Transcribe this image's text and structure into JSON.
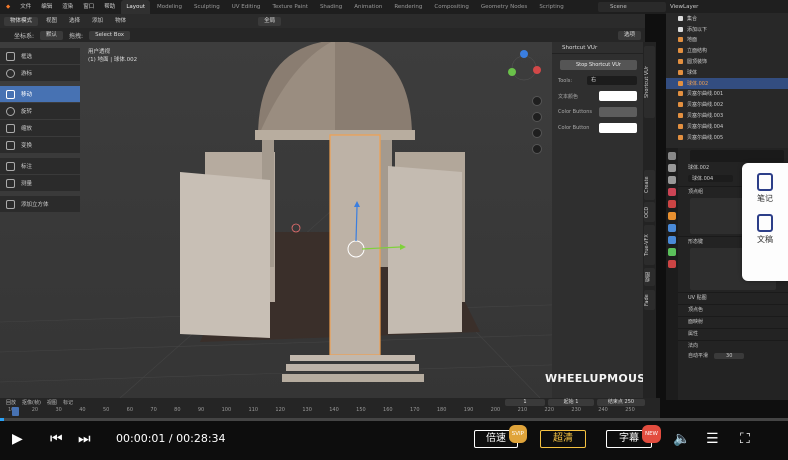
{
  "topbar": {
    "menus": [
      "文件",
      "编辑",
      "渲染",
      "窗口",
      "帮助"
    ],
    "workspaces": [
      "Layout",
      "Modeling",
      "Sculpting",
      "UV Editing",
      "Texture Paint",
      "Shading",
      "Animation",
      "Rendering",
      "Compositing",
      "Geometry Nodes",
      "Scripting"
    ],
    "scene_label": "Scene",
    "view_layer_label": "ViewLayer"
  },
  "viewport_header": {
    "mode": "物体模式",
    "menus": [
      "视图",
      "选择",
      "添加",
      "物体"
    ],
    "orientation": "全局",
    "options_label": "选项"
  },
  "viewport_header2": {
    "coord_label": "坐标系:",
    "coord_value": "默认",
    "drag_label": "拖拽:",
    "drag_value": "Select Box"
  },
  "viewport_info": {
    "line1": "用户透视",
    "line2": "(1) 地面 | 球体.002"
  },
  "toolbar": {
    "tools": [
      {
        "label": "框选",
        "active": false
      },
      {
        "label": "游标",
        "active": false
      },
      {
        "label": "移动",
        "active": true
      },
      {
        "label": "旋转",
        "active": false
      },
      {
        "label": "缩放",
        "active": false
      },
      {
        "label": "变换",
        "active": false
      },
      {
        "label": "标注",
        "active": false
      },
      {
        "label": "测量",
        "active": false
      },
      {
        "label": "添加立方体",
        "active": false
      }
    ]
  },
  "npanel": {
    "title": "Shortcut VUr",
    "stop_button": "Stop Shortcut VUr",
    "tools_label": "Tools:",
    "tools_value": "右",
    "text_color_label": "文本颜色",
    "color_buttons_label": "Color Buttons",
    "color_button_label": "Color Button",
    "side_tabs": [
      "Shortcut VUr",
      "Create",
      "OCD",
      "True-VFX",
      "视图",
      "Fade"
    ]
  },
  "watermark": "WHEELUPMOUSE",
  "outliner": {
    "rows": [
      {
        "label": "集合",
        "selected": false
      },
      {
        "label": "添加以下",
        "selected": false
      },
      {
        "label": "地面",
        "selected": false
      },
      {
        "label": "立面结构",
        "selected": false
      },
      {
        "label": "圆顶装饰",
        "selected": false
      },
      {
        "label": "球体",
        "selected": false
      },
      {
        "label": "球体.002",
        "selected": true
      },
      {
        "label": "贝塞尔曲线.001",
        "selected": false
      },
      {
        "label": "贝塞尔曲线.002",
        "selected": false
      },
      {
        "label": "贝塞尔曲线.003",
        "selected": false
      },
      {
        "label": "贝塞尔曲线.004",
        "selected": false
      },
      {
        "label": "贝塞尔曲线.005",
        "selected": false
      }
    ]
  },
  "properties": {
    "breadcrumb": "球体.002",
    "object_name": "球体.004",
    "sections": [
      "顶点组",
      "形态键",
      "UV 贴图",
      "顶点色",
      "面映射",
      "属性",
      "法向"
    ],
    "autosmooth_label": "自动平滑",
    "autosmooth_value": "30"
  },
  "notes_widget": {
    "items": [
      "笔记",
      "文稿"
    ]
  },
  "timeline": {
    "menus": [
      "回放",
      "抠像(帧)",
      "视图",
      "标记"
    ],
    "ticks": [
      "10",
      "20",
      "30",
      "40",
      "50",
      "60",
      "70",
      "80",
      "90",
      "100",
      "110",
      "120",
      "130",
      "140",
      "150",
      "160",
      "170",
      "180",
      "190",
      "200",
      "210",
      "220",
      "230",
      "240",
      "250"
    ],
    "current_frame": "1",
    "start_label": "起始",
    "start_value": "1",
    "end_label": "结束点",
    "end_value": "250"
  },
  "player": {
    "current_time": "00:00:01",
    "separator": "/",
    "total_time": "00:28:34",
    "speed_label": "倍速",
    "speed_tag": "SVIP",
    "quality_label": "超清",
    "subtitle_label": "字幕",
    "subtitle_tag": "NEW",
    "progress": 0.005
  },
  "colors": {
    "accent": "#4772b3",
    "selection_orange": "#f0a050",
    "player_blue": "#29a1f7"
  }
}
